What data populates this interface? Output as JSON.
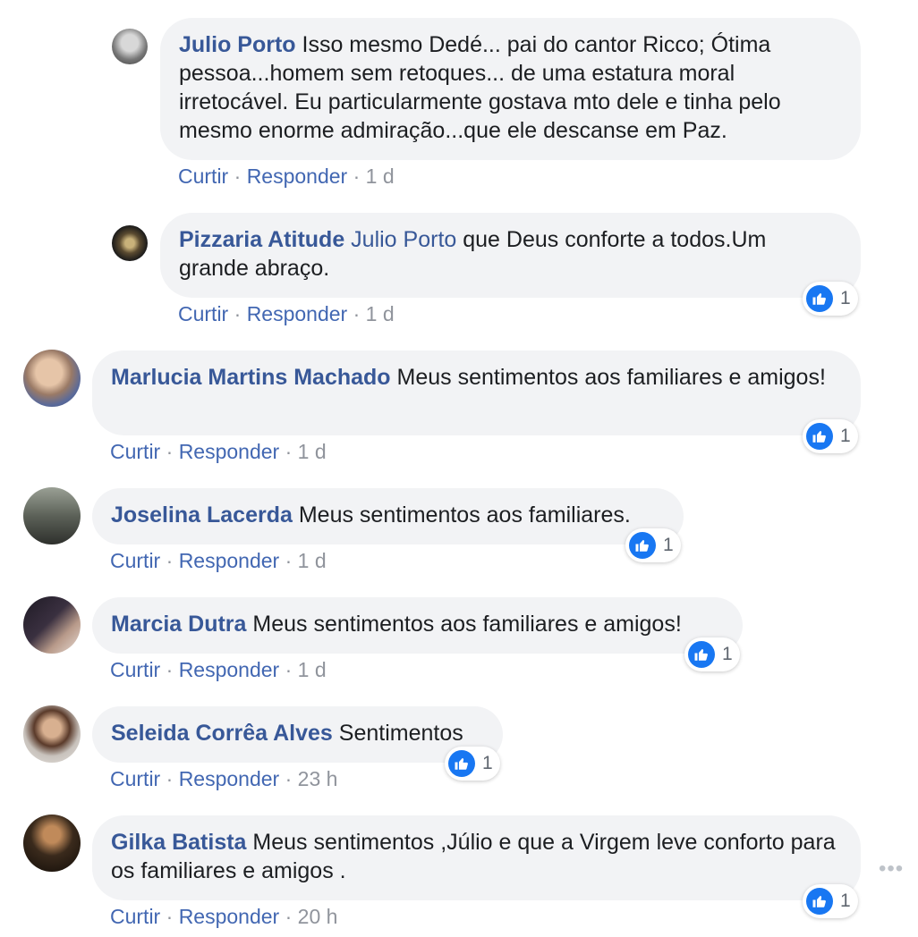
{
  "actions": {
    "like": "Curtir",
    "reply": "Responder",
    "sep": "·"
  },
  "comments": [
    {
      "author": "Julio Porto",
      "text": "Isso mesmo Dedé... pai do cantor Ricco; Ótima pessoa...homem sem retoques... de uma estatura moral irretocável. Eu particularmente gostava mto dele e tinha pelo mesmo enorme admiração...que ele descanse em Paz.",
      "time": "1 d",
      "avatar_colors": [
        "#bcbcbc",
        "#4a4a4a"
      ]
    },
    {
      "author": "Pizzaria Atitude",
      "mention": "Julio Porto",
      "text": "que Deus conforte a todos.Um grande abraço.",
      "time": "1 d",
      "likes": "1",
      "avatar_colors": [
        "#6b5a3a",
        "#1a1a1a"
      ]
    },
    {
      "author": "Marlucia Martins Machado",
      "text": "Meus sentimentos aos familiares e amigos!",
      "time": "1 d",
      "likes": "1",
      "avatar_colors": [
        "#c7a98f",
        "#6b7aa6"
      ]
    },
    {
      "author": "Joselina Lacerda",
      "text": "Meus sentimentos aos familiares.",
      "time": "1 d",
      "likes": "1",
      "avatar_colors": [
        "#8a8f86",
        "#3d3f3a"
      ]
    },
    {
      "author": "Marcia Dutra",
      "text": "Meus sentimentos aos familiares e amigos!",
      "time": "1 d",
      "likes": "1",
      "avatar_colors": [
        "#2b2630",
        "#8a6f62"
      ]
    },
    {
      "author": "Seleida Corrêa Alves",
      "text": "Sentimentos",
      "time": "23 h",
      "likes": "1",
      "avatar_colors": [
        "#cfcac4",
        "#2a2622"
      ]
    },
    {
      "author": "Gilka Batista",
      "text": "Meus sentimentos ,Júlio e que a Virgem leve conforto para os familiares e amigos .",
      "time": "20 h",
      "likes": "1",
      "avatar_colors": [
        "#3a2a1c",
        "#b88a5a"
      ]
    }
  ],
  "menu_icon": "more-dots-icon",
  "colors": {
    "name": "#385898",
    "link": "#4267b2",
    "bubble": "#f2f3f5",
    "like": "#1877f2"
  }
}
